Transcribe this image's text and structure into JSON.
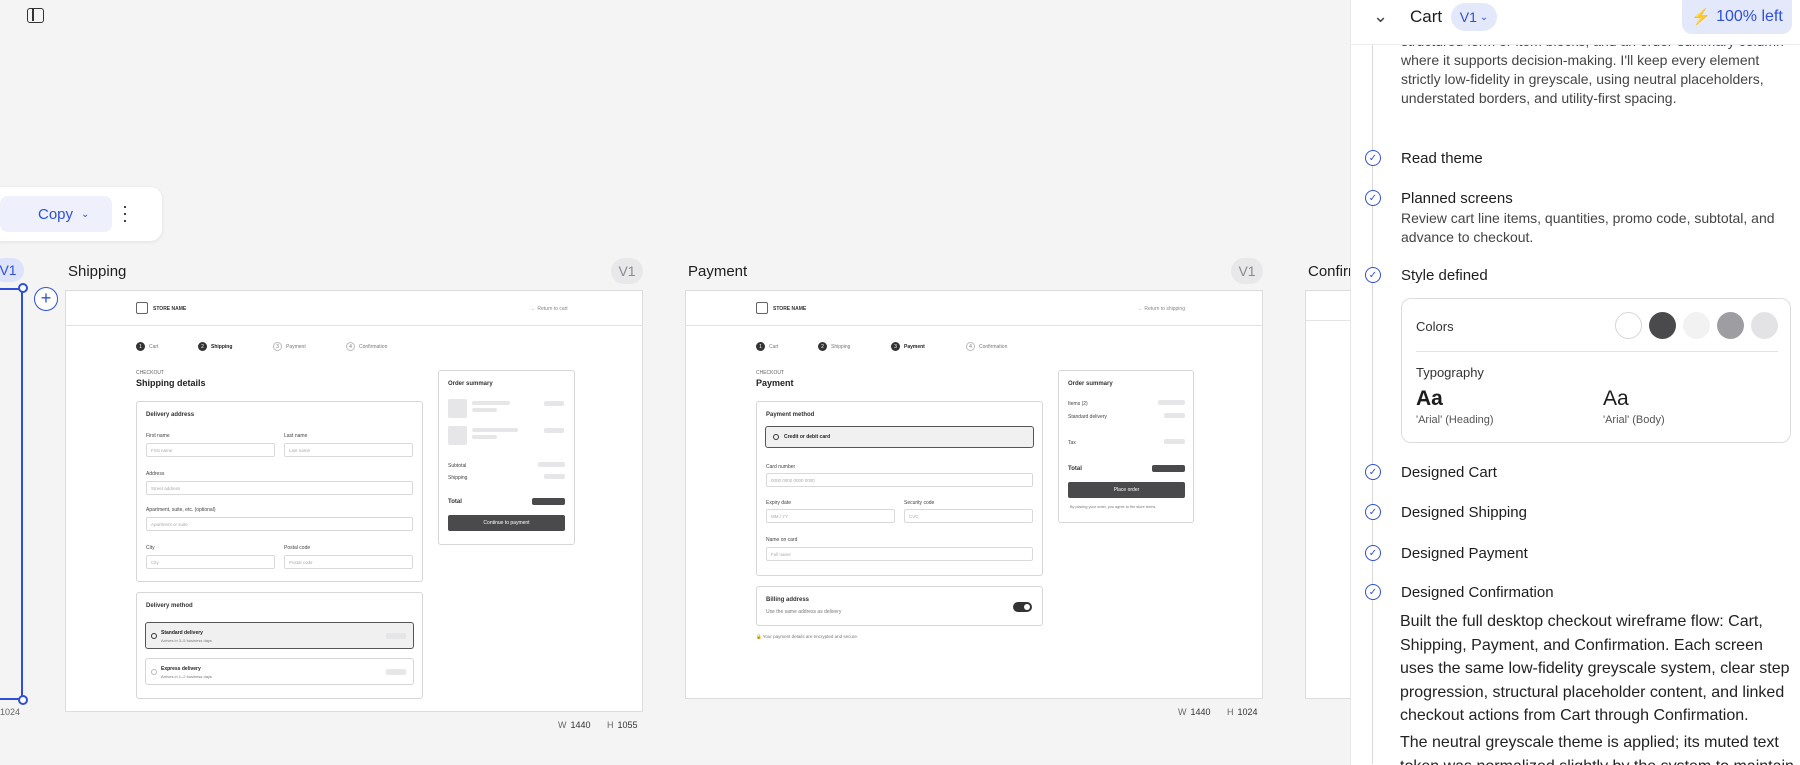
{
  "canvas": {
    "copy_label": "Copy",
    "partial_badge": "V1",
    "partial_size": "1024",
    "frames": [
      {
        "title": "Shipping",
        "version": "V1",
        "w": "1440",
        "h": "1055"
      },
      {
        "title": "Payment",
        "version": "V1",
        "w": "1440",
        "h": "1024"
      },
      {
        "title": "Confirma"
      }
    ],
    "w_label": "W",
    "h_label": "H"
  },
  "shipping": {
    "store": "STORE NAME",
    "back": "← Return to cart",
    "steps": [
      "Cart",
      "Shipping",
      "Payment",
      "Confirmation"
    ],
    "eyebrow": "CHECKOUT",
    "title": "Shipping details",
    "addr_title": "Delivery address",
    "first": "First name",
    "last": "Last name",
    "address": "Address",
    "street": "Street address",
    "apt": "Apartment, suite, etc. (optional)",
    "apt_ph": "Apartment or suite",
    "city": "City",
    "postal": "Postal code",
    "method_title": "Delivery method",
    "standard": "Standard delivery",
    "standard_sub": "Arrives in 3–5 business days",
    "express": "Express delivery",
    "express_sub": "Arrives in 1–2 business days",
    "summary": "Order summary",
    "subtotal": "Subtotal",
    "shipping": "Shipping",
    "total": "Total",
    "cta": "Continue to payment"
  },
  "payment": {
    "store": "STORE NAME",
    "back": "← Return to shipping",
    "steps": [
      "Cart",
      "Shipping",
      "Payment",
      "Confirmation"
    ],
    "eyebrow": "CHECKOUT",
    "title": "Payment",
    "method_title": "Payment method",
    "card_option": "Credit or debit card",
    "card_number": "Card number",
    "card_ph": "0000 0000 0000 0000",
    "expiry": "Expiry date",
    "expiry_ph": "MM / YY",
    "security": "Security code",
    "cvc": "CVC",
    "name": "Name on card",
    "name_ph": "Full name",
    "billing": "Billing address",
    "billing_sub": "Use the same address as delivery",
    "secure": "Your payment details are encrypted and secure.",
    "summary": "Order summary",
    "items": "Items (2)",
    "standard": "Standard delivery",
    "tax": "Tax",
    "total": "Total",
    "cta": "Place order",
    "terms": "By placing your order, you agree to the store terms."
  },
  "panel": {
    "title": "Cart",
    "version": "V1",
    "credits": "100% left",
    "intro": "structured form or item blocks, and an order-summary column where it supports decision-making. I'll keep every element strictly low-fidelity in greyscale, using neutral placeholders, understated borders, and utility-first spacing.",
    "steps": {
      "read": "Read theme",
      "planned": "Planned screens",
      "planned_desc": "Review cart line items, quantities, promo code, subtotal, and advance to checkout.",
      "style": "Style defined",
      "cart": "Designed Cart",
      "shipping": "Designed Shipping",
      "payment": "Designed Payment",
      "confirmation": "Designed Confirmation"
    },
    "style_card": {
      "colors": "Colors",
      "typography": "Typography",
      "aa": "Aa",
      "heading": "'Arial' (Heading)",
      "body": "'Arial' (Body)"
    },
    "swatch_colors": [
      "#ffffff",
      "#4a4a4d",
      "#f2f2f3",
      "#9e9ea2",
      "#e3e3e5"
    ],
    "summary": "Built the full desktop checkout wireframe flow: Cart, Shipping, Payment, and Confirmation. Each screen uses the same low-fidelity greyscale system, clear step progression, structural placeholder content, and linked checkout actions from Cart through Confirmation.",
    "summary2": "The neutral greyscale theme is applied; its muted text token was normalized slightly by the system to maintain"
  }
}
